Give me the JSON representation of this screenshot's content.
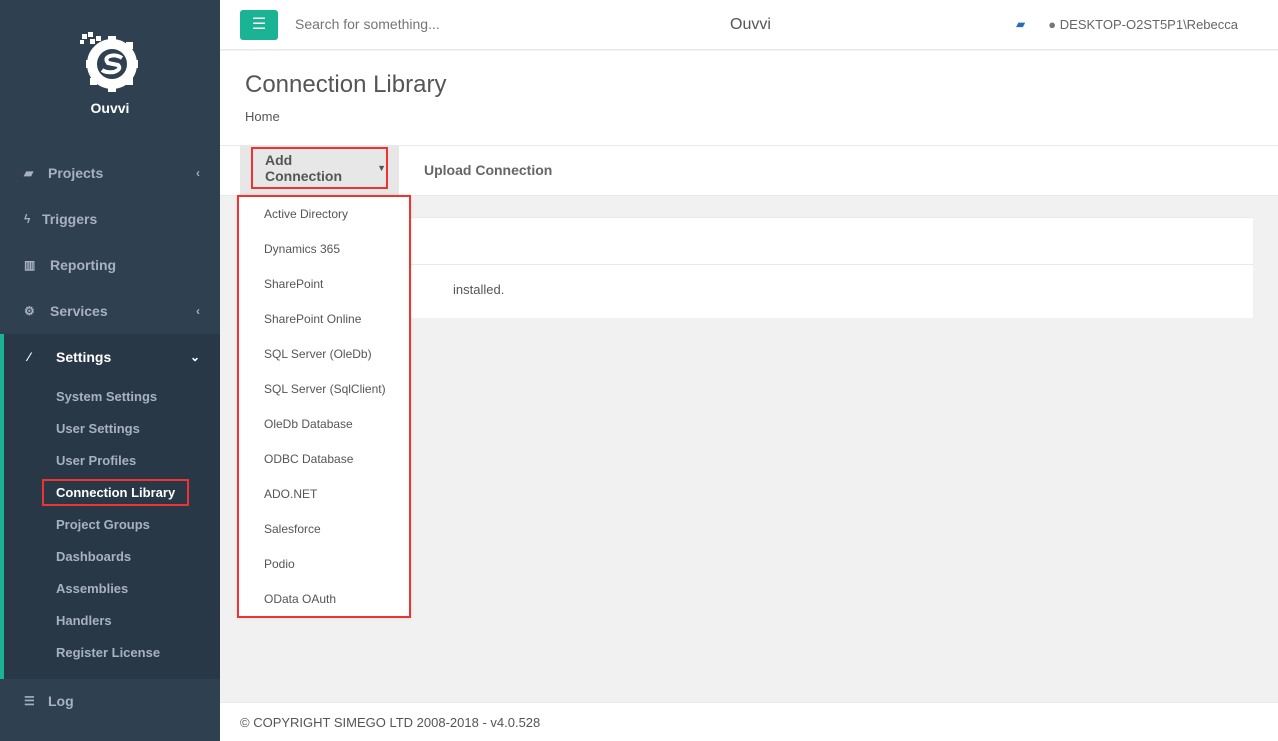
{
  "app": {
    "name": "Ouvvi",
    "title": "Ouvvi"
  },
  "sidebar": {
    "items": [
      {
        "label": "Projects",
        "icon": "book-icon"
      },
      {
        "label": "Triggers",
        "icon": "bolt-icon"
      },
      {
        "label": "Reporting",
        "icon": "bar-chart-icon"
      },
      {
        "label": "Services",
        "icon": "cogs-icon"
      },
      {
        "label": "Settings",
        "icon": "magic-wand-icon"
      },
      {
        "label": "Log",
        "icon": "list-icon"
      }
    ],
    "settings_sub": [
      "System Settings",
      "User Settings",
      "User Profiles",
      "Connection Library",
      "Project Groups",
      "Dashboards",
      "Assemblies",
      "Handlers",
      "Register License"
    ]
  },
  "topbar": {
    "search_placeholder": "Search for something...",
    "user": "DESKTOP-O2ST5P1\\Rebecca"
  },
  "page": {
    "title": "Connection Library",
    "breadcrumb": "Home",
    "add_label": "Add Connection",
    "upload_label": "Upload Connection",
    "message": "installed."
  },
  "dropdown": [
    "Active Directory",
    "Dynamics 365",
    "SharePoint",
    "SharePoint Online",
    "SQL Server (OleDb)",
    "SQL Server (SqlClient)",
    "OleDb Database",
    "ODBC Database",
    "ADO.NET",
    "Salesforce",
    "Podio",
    "OData OAuth"
  ],
  "footer": "© COPYRIGHT SIMEGO LTD 2008-2018 - v4.0.528",
  "colors": {
    "sidebar": "#2f4050",
    "accent": "#1ab394",
    "highlight": "#ee3333"
  }
}
